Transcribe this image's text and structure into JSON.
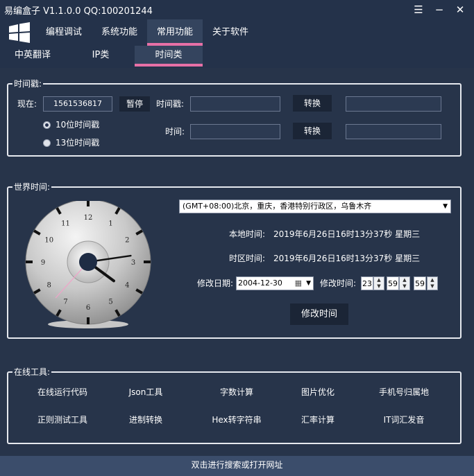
{
  "window": {
    "title": "易编盒子 V1.1.0.0 QQ:100201244"
  },
  "menu": {
    "items": [
      {
        "label": "编程调试"
      },
      {
        "label": "系统功能"
      },
      {
        "label": "常用功能"
      },
      {
        "label": "关于软件"
      }
    ],
    "active": "常用功能"
  },
  "subtabs": {
    "items": [
      {
        "label": "中英翻译"
      },
      {
        "label": "IP类"
      },
      {
        "label": "时间类"
      }
    ],
    "active": "时间类"
  },
  "timestamp": {
    "group_title": "时间戳:",
    "now_label": "现在:",
    "now_value": "1561536817",
    "pause_label": "暂停",
    "ts_label": "时间戳:",
    "ts_value": "",
    "time_label": "时间:",
    "time_value": "",
    "convert_label_1": "转换",
    "convert_label_2": "转换",
    "result_1": "",
    "result_2": "",
    "radio_10": "10位时间戳",
    "radio_13": "13位时间戳",
    "radio_selected": "10位时间戳"
  },
  "world_time": {
    "group_title": "世界时间:",
    "timezone": "(GMT+08:00)北京，重庆，香港特别行政区，乌鲁木齐",
    "local_label": "本地时间:",
    "local_value": "2019年6月26日16时13分37秒 星期三",
    "zone_label": "时区时间:",
    "zone_value": "2019年6月26日16时13分37秒 星期三",
    "modify_date_label": "修改日期:",
    "modify_date_value": "2004-12-30",
    "modify_time_label": "修改时间:",
    "hour": "23",
    "minute": "59",
    "second": "59",
    "modify_button": "修改时间",
    "clock": {
      "numbers": [
        "12",
        "1",
        "2",
        "3",
        "4",
        "5",
        "6",
        "7",
        "8",
        "9",
        "10",
        "11"
      ],
      "hour": 4,
      "minute": 13,
      "second": 37
    }
  },
  "online_tools": {
    "group_title": "在线工具:",
    "items": [
      {
        "label": "在线运行代码"
      },
      {
        "label": "Json工具"
      },
      {
        "label": "字数计算"
      },
      {
        "label": "图片优化"
      },
      {
        "label": "手机号归属地"
      },
      {
        "label": "正则测试工具"
      },
      {
        "label": "进制转换"
      },
      {
        "label": "Hex转字符串"
      },
      {
        "label": "汇率计算"
      },
      {
        "label": "IT词汇发音"
      }
    ]
  },
  "statusbar": {
    "text": "双击进行搜索或打开网址"
  },
  "colors": {
    "background": "#27344a",
    "accent": "#e770a6",
    "statusbar": "#3b4d6b"
  }
}
